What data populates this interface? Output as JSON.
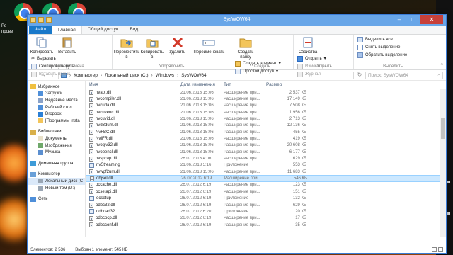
{
  "window": {
    "title": "SysWOW64"
  },
  "colors": {
    "title_bar": "#68a6e8",
    "file_tab": "#1979ca",
    "selection": "#cce8ff",
    "close": "#c7403a"
  },
  "desktop": {
    "labels": [
      "Ре",
      "прове"
    ]
  },
  "tabs": [
    "Файл",
    "Главная",
    "Общий доступ",
    "Вид"
  ],
  "ribbon": {
    "clipboard": {
      "copy": "Копировать",
      "paste": "Вставить",
      "cut": "Вырезать",
      "copy_path": "Скопировать путь",
      "paste_shortcut": "Вставить ярлык",
      "label": "Буфер обмена"
    },
    "organize": {
      "move_to": "Переместить в",
      "copy_to": "Копировать в",
      "delete": "Удалить",
      "rename": "Переименовать",
      "label": "Упорядочить"
    },
    "create": {
      "new_folder": "Создать папку",
      "new_item": "Создать элемент",
      "easy_access": "Простой доступ",
      "label": "Создать"
    },
    "open": {
      "properties": "Свойства",
      "open": "Открыть",
      "edit": "Изменить",
      "history": "Журнал",
      "label": "Открыть"
    },
    "select": {
      "select_all": "Выделить все",
      "select_none": "Снять выделение",
      "invert": "Обратить выделение",
      "label": "Выделить"
    }
  },
  "address": {
    "crumbs": [
      "Компьютер",
      "Локальный диск (C:)",
      "Windows",
      "SysWOW64"
    ],
    "search_placeholder": "Поиск: SysWOW64"
  },
  "nav": [
    {
      "label": "Избранное",
      "icon": "star-icon",
      "child": false,
      "gap": false
    },
    {
      "label": "Загрузки",
      "icon": "downloads-icon",
      "child": true,
      "gap": false
    },
    {
      "label": "Недавние места",
      "icon": "recent-places-icon",
      "child": true,
      "gap": false
    },
    {
      "label": "Рабочий стол",
      "icon": "desktop-icon",
      "child": true,
      "gap": false
    },
    {
      "label": "Dropbox",
      "icon": "dropbox-icon",
      "child": true,
      "gap": false
    },
    {
      "label": "[Программы Insta",
      "icon": "folder-icon",
      "child": true,
      "gap": false
    },
    {
      "label": "Библиотеки",
      "icon": "libraries-icon",
      "child": false,
      "gap": true
    },
    {
      "label": "Документы",
      "icon": "documents-icon",
      "child": true,
      "gap": false
    },
    {
      "label": "Изображения",
      "icon": "pictures-icon",
      "child": true,
      "gap": false
    },
    {
      "label": "Музыка",
      "icon": "music-icon",
      "child": true,
      "gap": false
    },
    {
      "label": "Домашняя группа",
      "icon": "homegroup-icon",
      "child": false,
      "gap": true
    },
    {
      "label": "Компьютер",
      "icon": "computer-icon",
      "child": false,
      "gap": true
    },
    {
      "label": "Локальный диск (C",
      "icon": "drive-icon",
      "child": true,
      "gap": false,
      "selected": true
    },
    {
      "label": "Новый том (D:)",
      "icon": "drive-icon",
      "child": true,
      "gap": false
    },
    {
      "label": "Сеть",
      "icon": "network-icon",
      "child": false,
      "gap": true
    }
  ],
  "columns": {
    "name": "Имя",
    "date": "Дата изменения",
    "type": "Тип",
    "size": "Размер"
  },
  "files": [
    {
      "name": "nvapi.dll",
      "date": "21.06.2013 15:06",
      "type": "Расширение при...",
      "size": "2 537 КБ",
      "icon": "dll"
    },
    {
      "name": "nvcompiler.dll",
      "date": "21.06.2013 15:06",
      "type": "Расширение при...",
      "size": "17 149 КБ",
      "icon": "dll"
    },
    {
      "name": "nvcuda.dll",
      "date": "21.06.2013 15:06",
      "type": "Расширение при...",
      "size": "7 508 КБ",
      "icon": "dll"
    },
    {
      "name": "nvcuvenc.dll",
      "date": "21.06.2013 15:06",
      "type": "Расширение при...",
      "size": "1 956 КБ",
      "icon": "dll"
    },
    {
      "name": "nvcuvid.dll",
      "date": "21.06.2013 15:06",
      "type": "Расширение при...",
      "size": "2 713 КБ",
      "icon": "dll"
    },
    {
      "name": "nvd3dum.dll",
      "date": "21.06.2013 15:06",
      "type": "Расширение при...",
      "size": "12 136 КБ",
      "icon": "dll"
    },
    {
      "name": "NvFBC.dll",
      "date": "21.06.2013 15:06",
      "type": "Расширение при...",
      "size": "455 КБ",
      "icon": "dll"
    },
    {
      "name": "NvIFR.dll",
      "date": "21.06.2013 15:06",
      "type": "Расширение при...",
      "size": "419 КБ",
      "icon": "dll"
    },
    {
      "name": "nvoglv32.dll",
      "date": "21.06.2013 15:06",
      "type": "Расширение при...",
      "size": "20 608 КБ",
      "icon": "dll"
    },
    {
      "name": "nvopencl.dll",
      "date": "21.06.2013 15:06",
      "type": "Расширение при...",
      "size": "6 177 КБ",
      "icon": "dll"
    },
    {
      "name": "nvspcap.dll",
      "date": "26.07.2013 4:06",
      "type": "Расширение при...",
      "size": "629 КБ",
      "icon": "dll"
    },
    {
      "name": "nvStreaming",
      "date": "21.06.2013 5:16",
      "type": "Приложение",
      "size": "553 КБ",
      "icon": "exe"
    },
    {
      "name": "nvwgf2um.dll",
      "date": "21.06.2013 15:06",
      "type": "Расширение при...",
      "size": "11 683 КБ",
      "icon": "dll"
    },
    {
      "name": "objsel.dll",
      "date": "26.07.2012 6:19",
      "type": "Расширение при...",
      "size": "546 КБ",
      "icon": "dll",
      "selected": true
    },
    {
      "name": "occache.dll",
      "date": "26.07.2012 6:19",
      "type": "Расширение при...",
      "size": "123 КБ",
      "icon": "dll"
    },
    {
      "name": "ocsetapi.dll",
      "date": "26.07.2012 6:19",
      "type": "Расширение при...",
      "size": "151 КБ",
      "icon": "dll"
    },
    {
      "name": "ocsetup",
      "date": "26.07.2012 6:19",
      "type": "Приложение",
      "size": "132 КБ",
      "icon": "exe"
    },
    {
      "name": "odbc32.dll",
      "date": "26.07.2012 6:19",
      "type": "Расширение при...",
      "size": "629 КБ",
      "icon": "dll"
    },
    {
      "name": "odbcad32",
      "date": "26.07.2012 6:20",
      "type": "Приложение",
      "size": "20 КБ",
      "icon": "exe"
    },
    {
      "name": "odbcbcp.dll",
      "date": "26.07.2012 6:19",
      "type": "Расширение при...",
      "size": "17 КБ",
      "icon": "dll"
    },
    {
      "name": "odbcconf.dll",
      "date": "26.07.2012 6:19",
      "type": "Расширение при...",
      "size": "35 КБ",
      "icon": "dll"
    }
  ],
  "status": {
    "count": "Элементов: 2 536",
    "selection": "Выбран 1 элемент: 545 КБ"
  }
}
